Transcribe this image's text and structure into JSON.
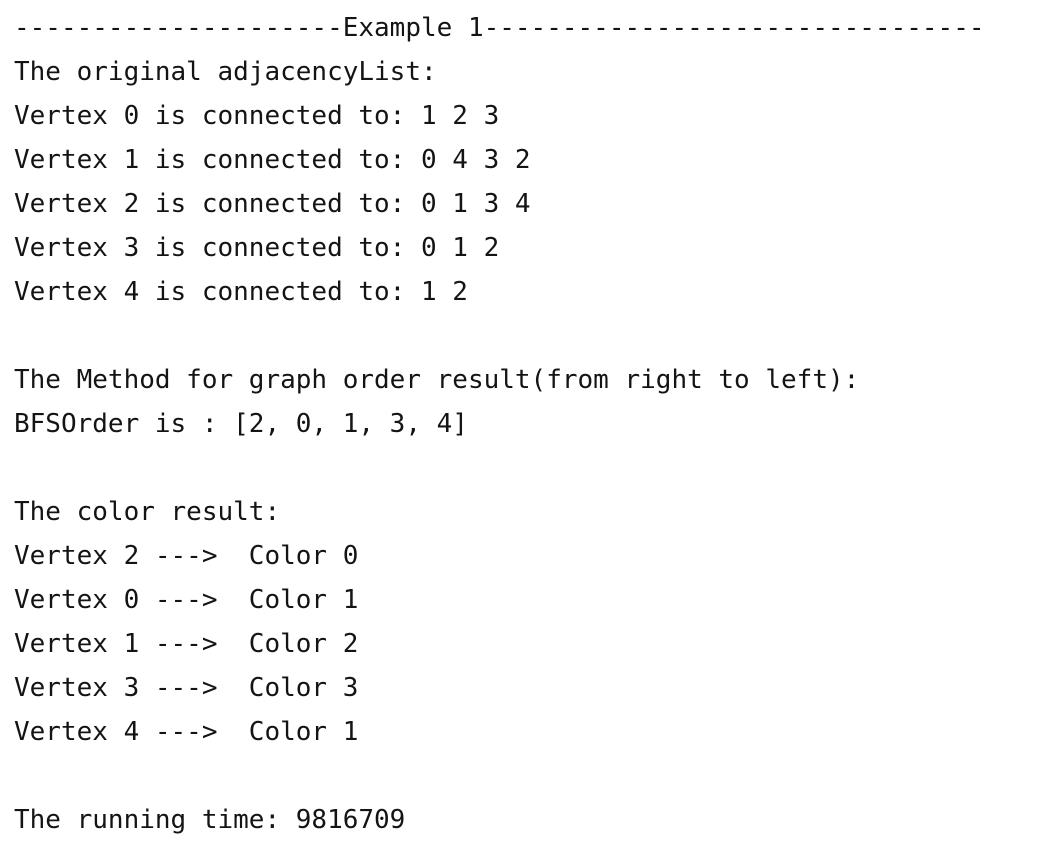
{
  "console": {
    "separator": "---------------------Example 1--------------------------------",
    "adjacency_header": "The original adjacencyList:",
    "adjacency": [
      "Vertex 0 is connected to: 1 2 3",
      "Vertex 1 is connected to: 0 4 3 2",
      "Vertex 2 is connected to: 0 1 3 4",
      "Vertex 3 is connected to: 0 1 2",
      "Vertex 4 is connected to: 1 2"
    ],
    "method_header": "The Method for graph order result(from right to left):",
    "bfs_order": "BFSOrder is : [2, 0, 1, 3, 4]",
    "color_header": "The color result:",
    "colors": [
      "Vertex 2 --->  Color 0",
      "Vertex 0 --->  Color 1",
      "Vertex 1 --->  Color 2",
      "Vertex 3 --->  Color 3",
      "Vertex 4 --->  Color 1"
    ],
    "running_time": "The running time: 9816709"
  }
}
